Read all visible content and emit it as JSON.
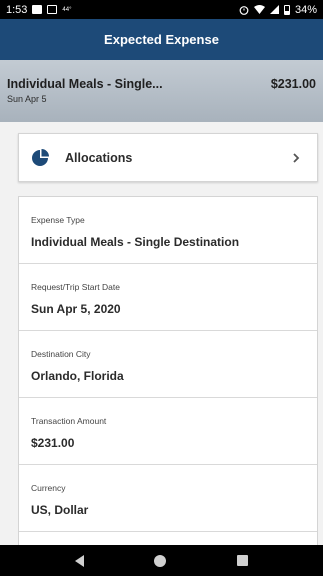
{
  "status": {
    "time": "1:53",
    "notif_small": "44°",
    "battery": "34%"
  },
  "header": {
    "title": "Expected Expense"
  },
  "summary": {
    "title": "Individual Meals - Single...",
    "amount": "$231.00",
    "date": "Sun Apr 5"
  },
  "allocations": {
    "label": "Allocations",
    "icon": "pie-chart-icon",
    "chevron": "chevron-right-icon"
  },
  "details": [
    {
      "label": "Expense Type",
      "value": "Individual Meals - Single Destination"
    },
    {
      "label": "Request/Trip Start Date",
      "value": "Sun Apr 5, 2020"
    },
    {
      "label": "Destination City",
      "value": "Orlando, Florida"
    },
    {
      "label": "Transaction Amount",
      "value": "$231.00"
    },
    {
      "label": "Currency",
      "value": "US, Dollar"
    }
  ],
  "colors": {
    "header_bg": "#1d4a78",
    "accent_icon": "#1d4a78",
    "summary_bg": "#b7c0c9"
  }
}
